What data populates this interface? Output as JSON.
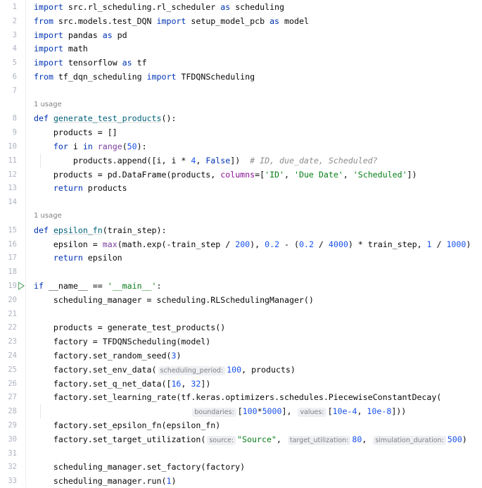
{
  "editor": {
    "rows": [
      {
        "kind": "code",
        "num": "1",
        "tokens": [
          [
            "kw",
            "import"
          ],
          [
            "p",
            " src.rl_scheduling.rl_scheduler "
          ],
          [
            "kw",
            "as"
          ],
          [
            "p",
            " scheduling"
          ]
        ]
      },
      {
        "kind": "code",
        "num": "2",
        "tokens": [
          [
            "kw",
            "from"
          ],
          [
            "p",
            " src.models.test_DQN "
          ],
          [
            "kw",
            "import"
          ],
          [
            "p",
            " setup_model_pcb "
          ],
          [
            "kw",
            "as"
          ],
          [
            "p",
            " model"
          ]
        ]
      },
      {
        "kind": "code",
        "num": "3",
        "tokens": [
          [
            "kw",
            "import"
          ],
          [
            "p",
            " pandas "
          ],
          [
            "kw",
            "as"
          ],
          [
            "p",
            " pd"
          ]
        ]
      },
      {
        "kind": "code",
        "num": "4",
        "tokens": [
          [
            "kw",
            "import"
          ],
          [
            "p",
            " math"
          ]
        ]
      },
      {
        "kind": "code",
        "num": "5",
        "tokens": [
          [
            "kw",
            "import"
          ],
          [
            "p",
            " tensorflow "
          ],
          [
            "kw",
            "as"
          ],
          [
            "p",
            " tf"
          ]
        ]
      },
      {
        "kind": "code",
        "num": "6",
        "tokens": [
          [
            "kw",
            "from"
          ],
          [
            "p",
            " tf_dqn_scheduling "
          ],
          [
            "kw",
            "import"
          ],
          [
            "p",
            " TFDQNScheduling"
          ]
        ]
      },
      {
        "kind": "code",
        "num": "7",
        "tokens": []
      },
      {
        "kind": "usage",
        "text": "1 usage"
      },
      {
        "kind": "code",
        "num": "8",
        "tokens": [
          [
            "kw",
            "def"
          ],
          [
            "p",
            " "
          ],
          [
            "fn",
            "generate_test_products"
          ],
          [
            "p",
            "():"
          ]
        ]
      },
      {
        "kind": "code",
        "num": "9",
        "tokens": [
          [
            "p",
            "    products = []"
          ]
        ]
      },
      {
        "kind": "code",
        "num": "10",
        "tokens": [
          [
            "p",
            "    "
          ],
          [
            "kw",
            "for"
          ],
          [
            "p",
            " i "
          ],
          [
            "kw",
            "in"
          ],
          [
            "p",
            " "
          ],
          [
            "bi",
            "range"
          ],
          [
            "p",
            "("
          ],
          [
            "num",
            "50"
          ],
          [
            "p",
            "):"
          ]
        ]
      },
      {
        "kind": "code",
        "num": "11",
        "guide": true,
        "tokens": [
          [
            "p",
            "        products.append([i, i * "
          ],
          [
            "num",
            "4"
          ],
          [
            "p",
            ", "
          ],
          [
            "kw",
            "False"
          ],
          [
            "p",
            "])  "
          ],
          [
            "cm",
            "# ID, due_date, Scheduled?"
          ]
        ]
      },
      {
        "kind": "code",
        "num": "12",
        "tokens": [
          [
            "p",
            "    products = pd.DataFrame(products, "
          ],
          [
            "param",
            "columns"
          ],
          [
            "p",
            "=["
          ],
          [
            "str",
            "'ID'"
          ],
          [
            "p",
            ", "
          ],
          [
            "str",
            "'Due Date'"
          ],
          [
            "p",
            ", "
          ],
          [
            "str",
            "'Scheduled'"
          ],
          [
            "p",
            "])"
          ]
        ]
      },
      {
        "kind": "code",
        "num": "13",
        "tokens": [
          [
            "p",
            "    "
          ],
          [
            "kw",
            "return"
          ],
          [
            "p",
            " products"
          ]
        ]
      },
      {
        "kind": "code",
        "num": "14",
        "tokens": []
      },
      {
        "kind": "usage",
        "text": "1 usage"
      },
      {
        "kind": "code",
        "num": "15",
        "tokens": [
          [
            "kw",
            "def"
          ],
          [
            "p",
            " "
          ],
          [
            "fn",
            "epsilon_fn"
          ],
          [
            "p",
            "(train_step):"
          ]
        ]
      },
      {
        "kind": "code",
        "num": "16",
        "tokens": [
          [
            "p",
            "    epsilon = "
          ],
          [
            "bi",
            "max"
          ],
          [
            "p",
            "(math.exp(-train_step / "
          ],
          [
            "num",
            "200"
          ],
          [
            "p",
            "), "
          ],
          [
            "num",
            "0.2"
          ],
          [
            "p",
            " - ("
          ],
          [
            "num",
            "0.2"
          ],
          [
            "p",
            " / "
          ],
          [
            "num",
            "4000"
          ],
          [
            "p",
            ") * train_step, "
          ],
          [
            "num",
            "1"
          ],
          [
            "p",
            " / "
          ],
          [
            "num",
            "1000"
          ],
          [
            "p",
            ")"
          ]
        ]
      },
      {
        "kind": "code",
        "num": "17",
        "tokens": [
          [
            "p",
            "    "
          ],
          [
            "kw",
            "return"
          ],
          [
            "p",
            " epsilon"
          ]
        ]
      },
      {
        "kind": "code",
        "num": "18",
        "tokens": []
      },
      {
        "kind": "code",
        "num": "19",
        "run": true,
        "tokens": [
          [
            "kw",
            "if"
          ],
          [
            "p",
            " __name__ == "
          ],
          [
            "str",
            "'__main__'"
          ],
          [
            "p",
            ":"
          ]
        ]
      },
      {
        "kind": "code",
        "num": "20",
        "tokens": [
          [
            "p",
            "    scheduling_manager = scheduling.RLSchedulingManager()"
          ]
        ]
      },
      {
        "kind": "code",
        "num": "21",
        "tokens": []
      },
      {
        "kind": "code",
        "num": "22",
        "tokens": [
          [
            "p",
            "    products = generate_test_products()"
          ]
        ]
      },
      {
        "kind": "code",
        "num": "23",
        "tokens": [
          [
            "p",
            "    factory = TFDQNScheduling(model)"
          ]
        ]
      },
      {
        "kind": "code",
        "num": "24",
        "tokens": [
          [
            "p",
            "    factory.set_random_seed("
          ],
          [
            "num",
            "3"
          ],
          [
            "p",
            ")"
          ]
        ]
      },
      {
        "kind": "code",
        "num": "25",
        "tokens": [
          [
            "p",
            "    factory.set_env_data("
          ],
          [
            "hint",
            "scheduling_period:"
          ],
          [
            "num",
            "100"
          ],
          [
            "p",
            ", products)"
          ]
        ]
      },
      {
        "kind": "code",
        "num": "26",
        "tokens": [
          [
            "p",
            "    factory.set_q_net_data(["
          ],
          [
            "num",
            "16"
          ],
          [
            "p",
            ", "
          ],
          [
            "num",
            "32"
          ],
          [
            "p",
            "])"
          ]
        ]
      },
      {
        "kind": "code",
        "num": "27",
        "tokens": [
          [
            "p",
            "    factory.set_learning_rate(tf.keras.optimizers.schedules.PiecewiseConstantDecay("
          ]
        ]
      },
      {
        "kind": "code",
        "num": "28",
        "guide": true,
        "tokens": [
          [
            "p",
            "                                "
          ],
          [
            "hint",
            "boundaries:"
          ],
          [
            "p",
            "["
          ],
          [
            "num",
            "100"
          ],
          [
            "p",
            "*"
          ],
          [
            "num",
            "5000"
          ],
          [
            "p",
            "], "
          ],
          [
            "hint",
            "values:"
          ],
          [
            "p",
            "["
          ],
          [
            "num",
            "10e-4"
          ],
          [
            "p",
            ", "
          ],
          [
            "num",
            "10e-8"
          ],
          [
            "p",
            "]))"
          ]
        ]
      },
      {
        "kind": "code",
        "num": "29",
        "tokens": [
          [
            "p",
            "    factory.set_epsilon_fn(epsilon_fn)"
          ]
        ]
      },
      {
        "kind": "code",
        "num": "30",
        "tokens": [
          [
            "p",
            "    factory.set_target_utilization("
          ],
          [
            "hint",
            "source:"
          ],
          [
            "str",
            "\"Source\""
          ],
          [
            "p",
            ", "
          ],
          [
            "hint",
            "target_utilization:"
          ],
          [
            "num",
            "80"
          ],
          [
            "p",
            ", "
          ],
          [
            "hint",
            "simulation_duration:"
          ],
          [
            "num",
            "500"
          ],
          [
            "p",
            ")"
          ]
        ]
      },
      {
        "kind": "code",
        "num": "31",
        "tokens": []
      },
      {
        "kind": "code",
        "num": "32",
        "tokens": [
          [
            "p",
            "    scheduling_manager.set_factory(factory)"
          ]
        ]
      },
      {
        "kind": "code",
        "num": "33",
        "tokens": [
          [
            "p",
            "    scheduling_manager.run("
          ],
          [
            "num",
            "1"
          ],
          [
            "p",
            ")"
          ]
        ]
      }
    ]
  }
}
